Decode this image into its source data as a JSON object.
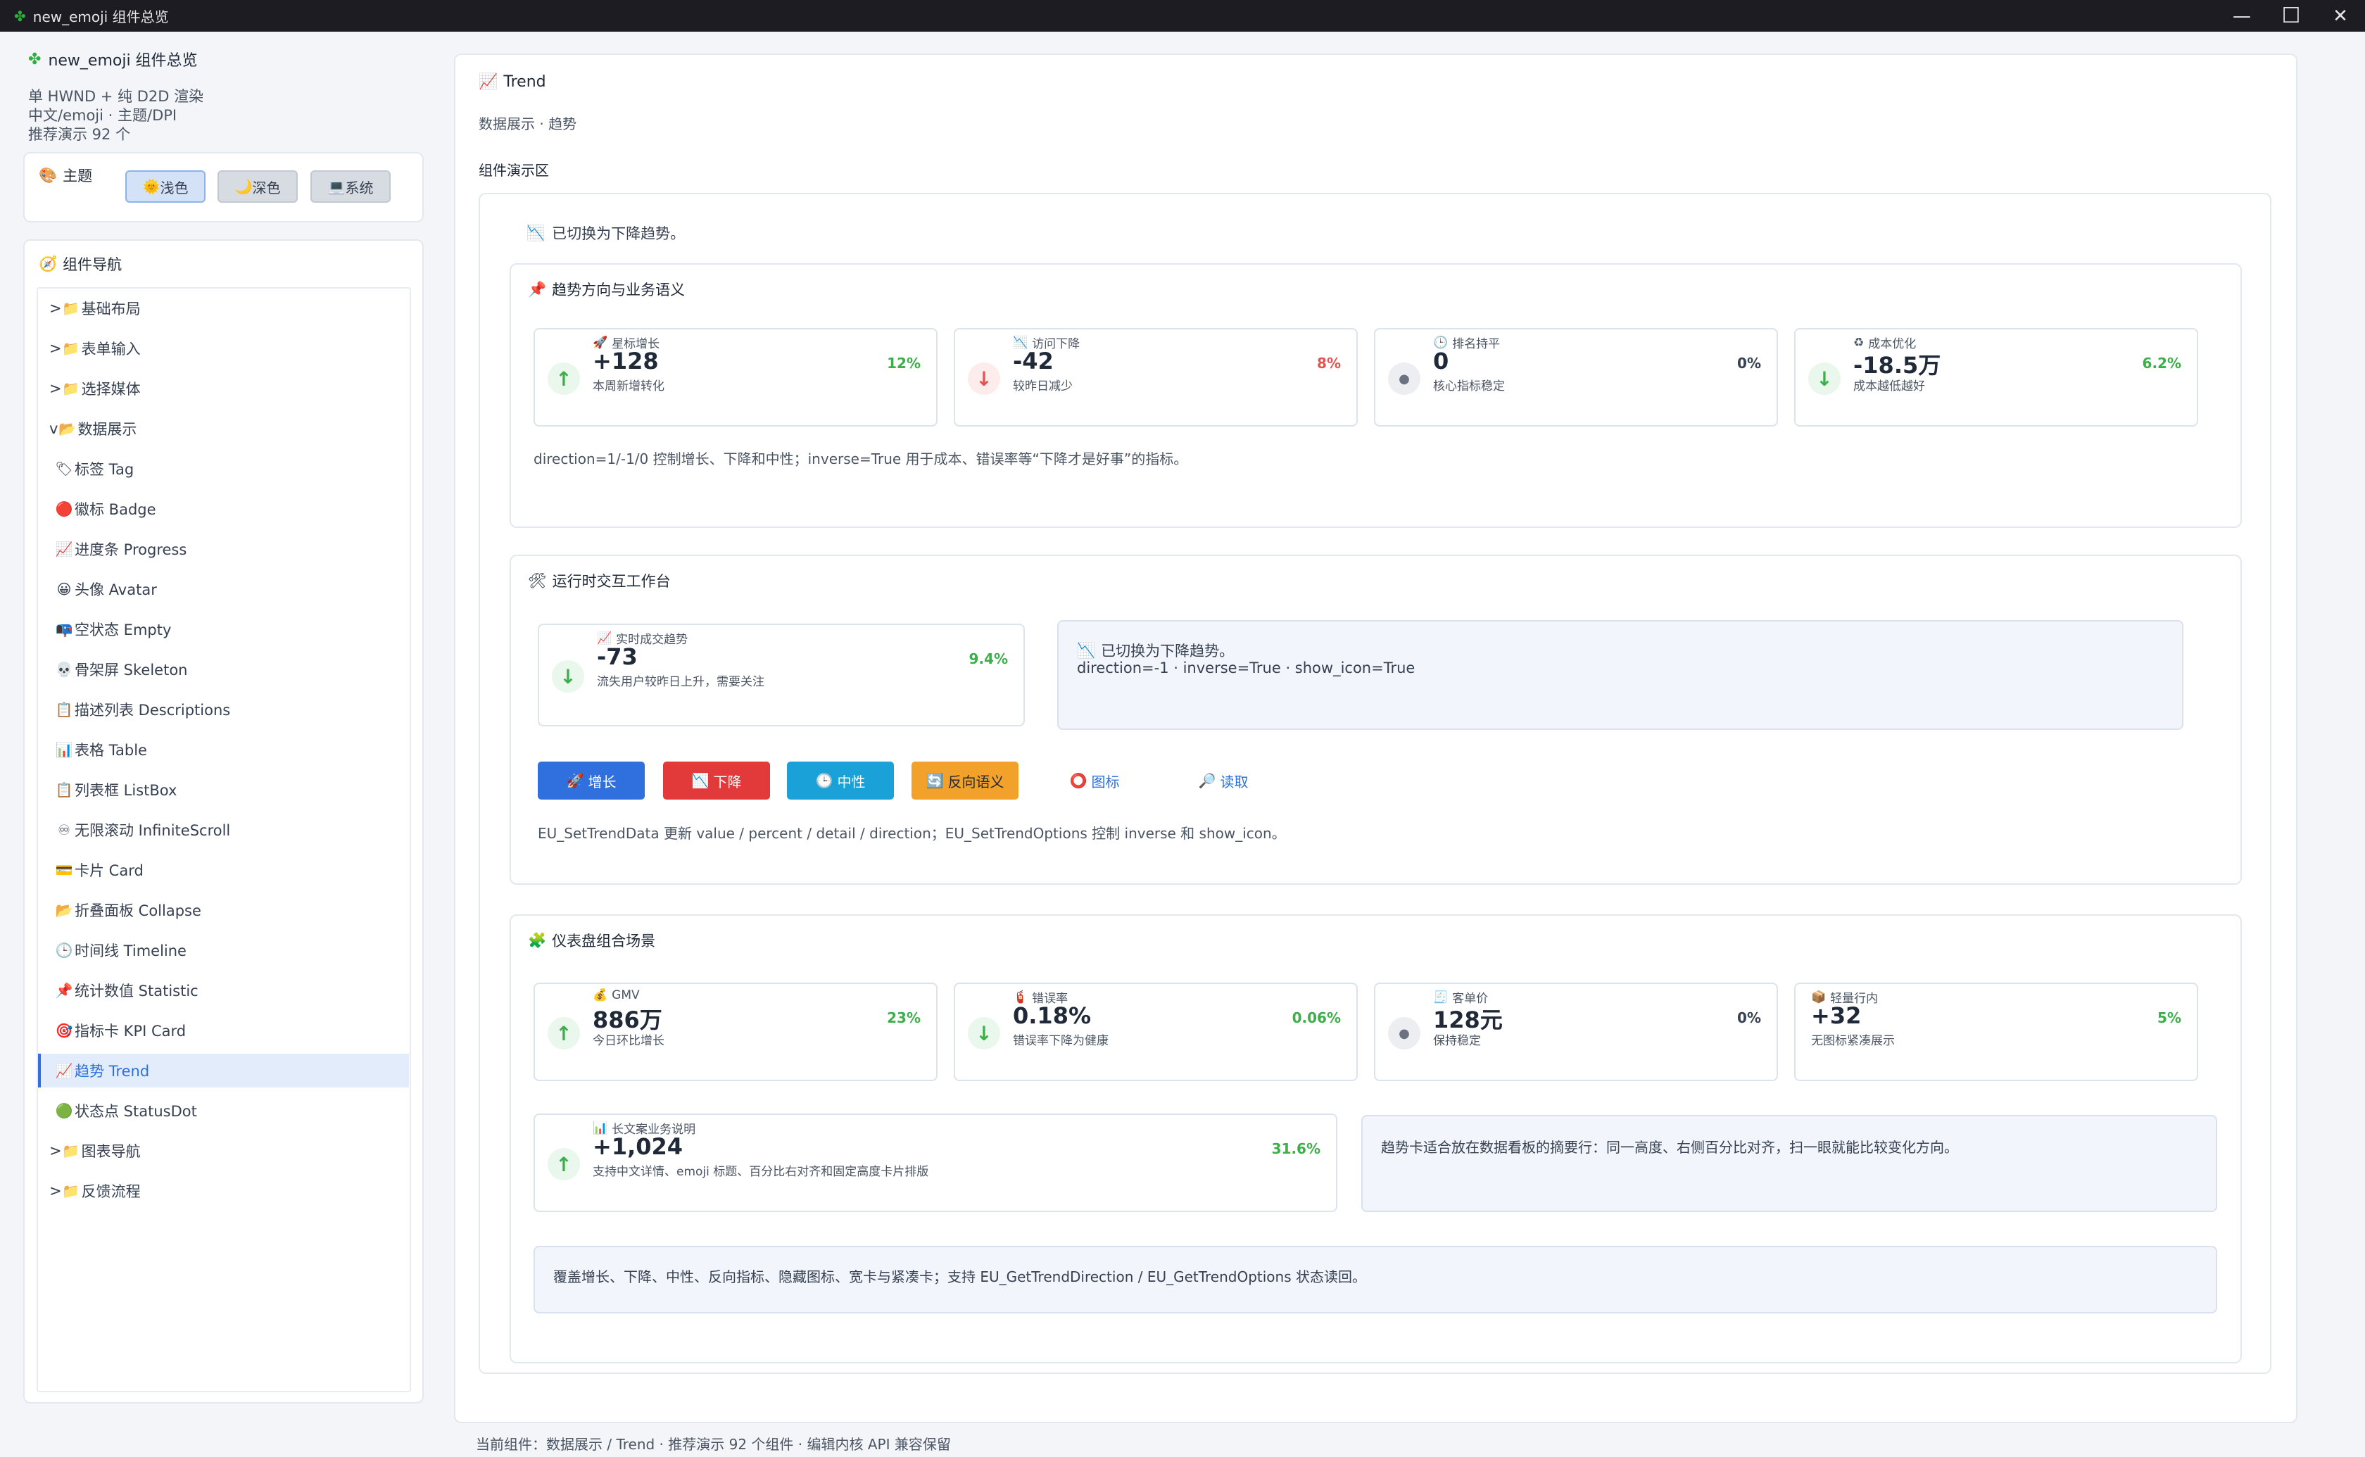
{
  "window": {
    "title": "new_emoji 组件总览",
    "icon": "puzzle-icon",
    "controls": [
      "—",
      "☐",
      "✕"
    ]
  },
  "app": {
    "name": "new_emoji 组件总览",
    "subtitle_lines": [
      "单 HWND + 纯 D2D 渲染",
      "中文/emoji · 主题/DPI",
      "推荐演示 92 个"
    ]
  },
  "theme": {
    "label": "主题",
    "buttons": [
      {
        "label": "浅色",
        "icon": "🌞"
      },
      {
        "label": "深色",
        "icon": "🌙"
      },
      {
        "label": "系统",
        "icon": "💻"
      }
    ],
    "active_index": 0
  },
  "nav": {
    "label": "组件导航",
    "items": [
      {
        "prefix": ">",
        "icon": "📁",
        "label": "基础布局"
      },
      {
        "prefix": ">",
        "icon": "📁",
        "label": "表单输入"
      },
      {
        "prefix": ">",
        "icon": "📁",
        "label": "选择媒体"
      },
      {
        "prefix": "v",
        "icon": "📂",
        "label": "数据展示"
      },
      {
        "prefix": "",
        "icon": "🏷",
        "label": "标签 Tag"
      },
      {
        "prefix": "",
        "icon": "🔴",
        "label": "徽标 Badge"
      },
      {
        "prefix": "",
        "icon": "📈",
        "label": "进度条 Progress"
      },
      {
        "prefix": "",
        "icon": "😀",
        "label": "头像 Avatar"
      },
      {
        "prefix": "",
        "icon": "📭",
        "label": "空状态 Empty"
      },
      {
        "prefix": "",
        "icon": "💀",
        "label": "骨架屏 Skeleton"
      },
      {
        "prefix": "",
        "icon": "📋",
        "label": "描述列表 Descriptions"
      },
      {
        "prefix": "",
        "icon": "📊",
        "label": "表格 Table"
      },
      {
        "prefix": "",
        "icon": "📋",
        "label": "列表框 ListBox"
      },
      {
        "prefix": "",
        "icon": "♾",
        "label": "无限滚动 InfiniteScroll"
      },
      {
        "prefix": "",
        "icon": "💳",
        "label": "卡片 Card"
      },
      {
        "prefix": "",
        "icon": "📂",
        "label": "折叠面板 Collapse"
      },
      {
        "prefix": "",
        "icon": "🕒",
        "label": "时间线 Timeline"
      },
      {
        "prefix": "",
        "icon": "📌",
        "label": "统计数值 Statistic"
      },
      {
        "prefix": "",
        "icon": "🎯",
        "label": "指标卡 KPI Card"
      },
      {
        "prefix": "",
        "icon": "📈",
        "label": "趋势 Trend"
      },
      {
        "prefix": "",
        "icon": "🟢",
        "label": "状态点 StatusDot"
      },
      {
        "prefix": ">",
        "icon": "📁",
        "label": "图表导航"
      },
      {
        "prefix": ">",
        "icon": "📁",
        "label": "反馈流程"
      }
    ],
    "active_index": 19
  },
  "page": {
    "title": "Trend",
    "title_icon": "📈",
    "breadcrumb": "数据展示 · 趋势",
    "demo_label": "组件演示区",
    "status_icon": "📉",
    "status_text": "已切换为下降趋势。"
  },
  "section1": {
    "icon": "📌",
    "title": "趋势方向与业务语义",
    "cards": [
      {
        "icon": "🚀",
        "label": "星标增长",
        "value": "+128",
        "detail": "本周新增转化",
        "percent": "12%",
        "arrow": "↑",
        "kind": "up",
        "pcolor": "green"
      },
      {
        "icon": "📉",
        "label": "访问下降",
        "value": "-42",
        "detail": "较昨日减少",
        "percent": "8%",
        "arrow": "↓",
        "kind": "down-bad",
        "pcolor": "red"
      },
      {
        "icon": "🕒",
        "label": "排名持平",
        "value": "0",
        "detail": "核心指标稳定",
        "percent": "0%",
        "arrow": "●",
        "kind": "flat",
        "pcolor": "gray"
      },
      {
        "icon": "♻",
        "label": "成本优化",
        "value": "-18.5万",
        "detail": "成本越低越好",
        "percent": "6.2%",
        "arrow": "↓",
        "kind": "down-good",
        "pcolor": "green"
      }
    ],
    "description": "direction=1/-1/0 控制增长、下降和中性；inverse=True 用于成本、错误率等“下降才是好事”的指标。"
  },
  "section2": {
    "icon": "🛠",
    "title": "运行时交互工作台",
    "card": {
      "icon": "📈",
      "label": "实时成交趋势",
      "value": "-73",
      "detail": "流失用户较昨日上升，需要关注",
      "percent": "9.4%",
      "arrow": "↓",
      "kind": "down-good",
      "pcolor": "green"
    },
    "panel_icon": "📉",
    "panel_line1": "已切换为下降趋势。",
    "panel_line2": "direction=-1 · inverse=True · show_icon=True",
    "buttons": [
      {
        "icon": "🚀",
        "label": "增长",
        "style": "blue"
      },
      {
        "icon": "📉",
        "label": "下降",
        "style": "red"
      },
      {
        "icon": "🕒",
        "label": "中性",
        "style": "cyan"
      },
      {
        "icon": "🔄",
        "label": "反向语义",
        "style": "orange"
      },
      {
        "icon": "⭕",
        "label": "图标",
        "style": "link"
      },
      {
        "icon": "🔎",
        "label": "读取",
        "style": "link"
      }
    ],
    "description": "EU_SetTrendData 更新 value / percent / detail / direction；EU_SetTrendOptions 控制 inverse 和 show_icon。"
  },
  "section3": {
    "icon": "🧩",
    "title": "仪表盘组合场景",
    "cards": [
      {
        "icon": "💰",
        "label": "GMV",
        "value": "886万",
        "detail": "今日环比增长",
        "percent": "23%",
        "arrow": "↑",
        "kind": "up",
        "pcolor": "green"
      },
      {
        "icon": "🧯",
        "label": "错误率",
        "value": "0.18%",
        "detail": "错误率下降为健康",
        "percent": "0.06%",
        "arrow": "↓",
        "kind": "down-good",
        "pcolor": "green"
      },
      {
        "icon": "🧾",
        "label": "客单价",
        "value": "128元",
        "detail": "保持稳定",
        "percent": "0%",
        "arrow": "●",
        "kind": "flat",
        "pcolor": "gray"
      },
      {
        "icon": "📦",
        "label": "轻量行内",
        "value": "+32",
        "detail": "无图标紧凑展示",
        "percent": "5%",
        "arrow": "",
        "kind": "none",
        "pcolor": "green"
      }
    ],
    "wide_card": {
      "icon": "📊",
      "label": "长文案业务说明",
      "value": "+1,024",
      "detail": "支持中文详情、emoji 标题、百分比右对齐和固定高度卡片排版",
      "percent": "31.6%",
      "arrow": "↑",
      "kind": "up",
      "pcolor": "green"
    },
    "side_note": "趋势卡适合放在数据看板的摘要行：同一高度、右侧百分比对齐，扫一眼就能比较变化方向。",
    "summary": "覆盖增长、下降、中性、反向指标、隐藏图标、宽卡与紧凑卡；支持 EU_GetTrendDirection / EU_GetTrendOptions 状态读回。"
  },
  "footer": {
    "text": "当前组件：数据展示 / Trend · 推荐演示 92 个组件 · 编辑内核 API 兼容保留"
  }
}
